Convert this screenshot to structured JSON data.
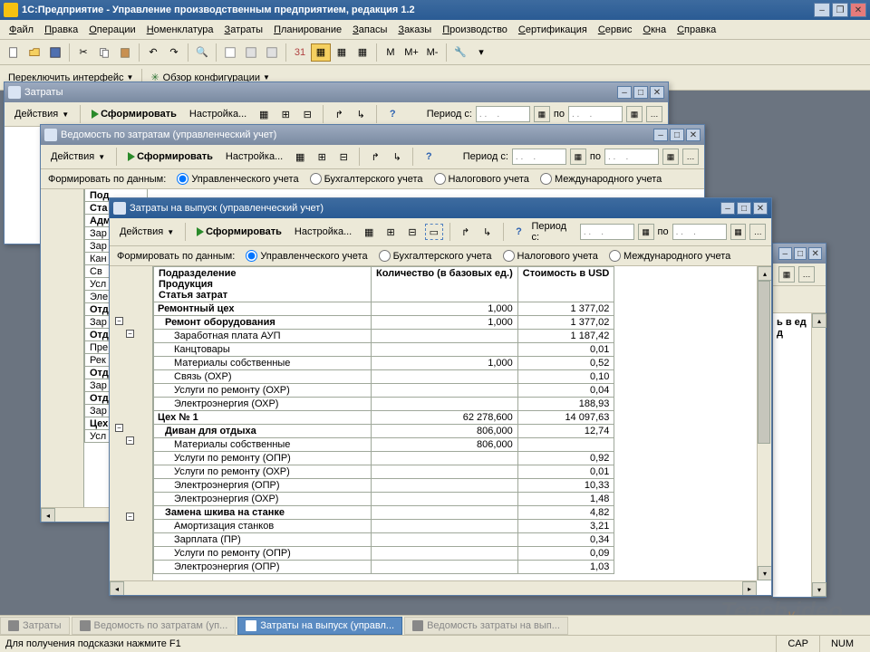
{
  "app_title": "1С:Предприятие - Управление производственным предприятием, редакция 1.2",
  "menu": [
    "Файл",
    "Правка",
    "Операции",
    "Номенклатура",
    "Затраты",
    "Планирование",
    "Запасы",
    "Заказы",
    "Производство",
    "Сертификация",
    "Сервис",
    "Окна",
    "Справка"
  ],
  "toolbar2": {
    "switch_iface": "Переключить интерфейс",
    "config_review": "Обзор конфигурации"
  },
  "win1": {
    "title": "Затраты",
    "actions": "Действия",
    "form_btn": "Сформировать",
    "settings": "Настройка...",
    "period_label": "Период с:",
    "period_to": "по",
    "date_ph": ". .    ."
  },
  "win2": {
    "title": "Ведомость по затратам (управленческий учет)",
    "actions": "Действия",
    "form_btn": "Сформировать",
    "settings": "Настройка...",
    "period_label": "Период с:",
    "period_to": "по",
    "date_ph": ". .    .",
    "form_by": "Формировать по данным:",
    "radio1": "Управленческого учета",
    "radio2": "Бухгалтерского учета",
    "radio3": "Налогового учета",
    "radio4": "Международного учета",
    "clipped_header": [
      "Под",
      "Ста"
    ],
    "clipped_rows": [
      "Адми",
      "Зар",
      "Зар",
      "Кан",
      "Св",
      "Усл",
      "Эле",
      "Отде",
      "Зар",
      "Отде",
      "Пре",
      "Рек",
      "Отде",
      "Зар",
      "Отде",
      "Зар",
      "Цех",
      "Усл"
    ]
  },
  "win3": {
    "title": "Затраты на выпуск (управленческий учет)",
    "actions": "Действия",
    "form_btn": "Сформировать",
    "settings": "Настройка...",
    "period_label": "Период с:",
    "period_to": "по",
    "date_ph": ". .    .",
    "form_by": "Формировать по данным:",
    "radio1": "Управленческого учета",
    "radio2": "Бухгалтерского учета",
    "radio3": "Налогового учета",
    "radio4": "Международного учета",
    "headers": {
      "col1a": "Подразделение",
      "col1b": "Продукция",
      "col1c": "Статья затрат",
      "col2": "Количество (в базовых ед.)",
      "col3": "Стоимость в USD"
    },
    "rows": [
      {
        "l": 0,
        "name": "Ремонтный цех",
        "qty": "1,000",
        "val": "1 377,02"
      },
      {
        "l": 1,
        "name": "Ремонт оборудования",
        "qty": "1,000",
        "val": "1 377,02"
      },
      {
        "l": 2,
        "name": "Заработная плата АУП",
        "qty": "",
        "val": "1 187,42"
      },
      {
        "l": 2,
        "name": "Канцтовары",
        "qty": "",
        "val": "0,01"
      },
      {
        "l": 2,
        "name": "Материалы собственные",
        "qty": "1,000",
        "val": "0,52"
      },
      {
        "l": 2,
        "name": "Связь (ОХР)",
        "qty": "",
        "val": "0,10"
      },
      {
        "l": 2,
        "name": "Услуги по ремонту (ОХР)",
        "qty": "",
        "val": "0,04"
      },
      {
        "l": 2,
        "name": "Электроэнергия (ОХР)",
        "qty": "",
        "val": "188,93"
      },
      {
        "l": 0,
        "name": "Цех № 1",
        "qty": "62 278,600",
        "val": "14 097,63"
      },
      {
        "l": 1,
        "name": "Диван для отдыха",
        "qty": "806,000",
        "val": "12,74"
      },
      {
        "l": 2,
        "name": "Материалы собственные",
        "qty": "806,000",
        "val": ""
      },
      {
        "l": 2,
        "name": "Услуги по ремонту (ОПР)",
        "qty": "",
        "val": "0,92"
      },
      {
        "l": 2,
        "name": "Услуги по ремонту (ОХР)",
        "qty": "",
        "val": "0,01"
      },
      {
        "l": 2,
        "name": "Электроэнергия (ОПР)",
        "qty": "",
        "val": "10,33"
      },
      {
        "l": 2,
        "name": "Электроэнергия (ОХР)",
        "qty": "",
        "val": "1,48"
      },
      {
        "l": 1,
        "name": "Замена шкива на станке",
        "qty": "",
        "val": "4,82"
      },
      {
        "l": 2,
        "name": "Амортизация станков",
        "qty": "",
        "val": "3,21"
      },
      {
        "l": 2,
        "name": "Зарплата (ПР)",
        "qty": "",
        "val": "0,34"
      },
      {
        "l": 2,
        "name": "Услуги по ремонту (ОПР)",
        "qty": "",
        "val": "0,09"
      },
      {
        "l": 2,
        "name": "Электроэнергия (ОПР)",
        "qty": "",
        "val": "1,03"
      }
    ]
  },
  "side_clipped": {
    "h1": "ь в ед",
    "h2": "д"
  },
  "taskbar": {
    "t1": "Затраты",
    "t2": "Ведомость по затратам (уп...",
    "t3": "Затраты на выпуск (управл...",
    "t4": "Ведомость затраты на вып..."
  },
  "statusbar": {
    "hint": "Для получения подсказки нажмите F1",
    "cap": "CAP",
    "num": "NUM"
  }
}
